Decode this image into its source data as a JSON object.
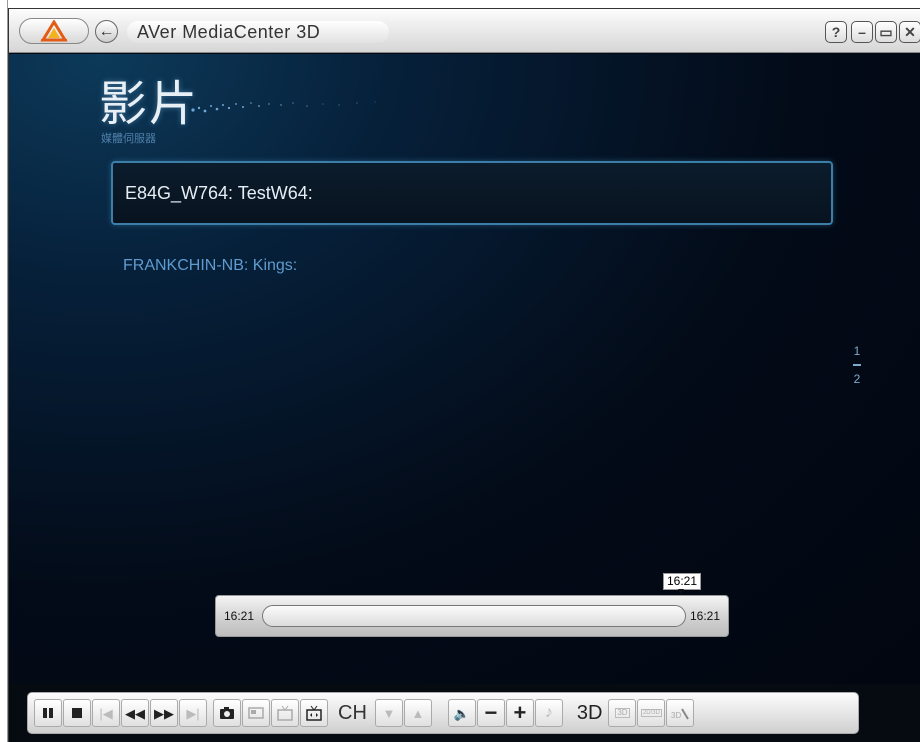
{
  "window": {
    "title": "AVer MediaCenter 3D"
  },
  "titlebar": {
    "help_label": "?",
    "minimize_label": "–",
    "maximize_label": "▭",
    "close_label": "✕"
  },
  "page": {
    "title": "影片",
    "subtitle": "媒體伺服器"
  },
  "servers": [
    {
      "label": "E84G_W764: TestW64:",
      "selected": true
    },
    {
      "label": "FRANKCHIN-NB: Kings:",
      "selected": false
    }
  ],
  "pager": {
    "current": "1",
    "total": "2"
  },
  "timebar": {
    "tooltip": "16:21",
    "start_time": "16:21",
    "end_time": "16:21"
  },
  "controls": {
    "ch_label": "CH",
    "threed_label": "3D",
    "btn_3d": "3D",
    "btn_2d3d": "2D/3D"
  },
  "colors": {
    "accent": "#3b7ea7",
    "background": "#030812",
    "link": "#5f9bd0"
  }
}
